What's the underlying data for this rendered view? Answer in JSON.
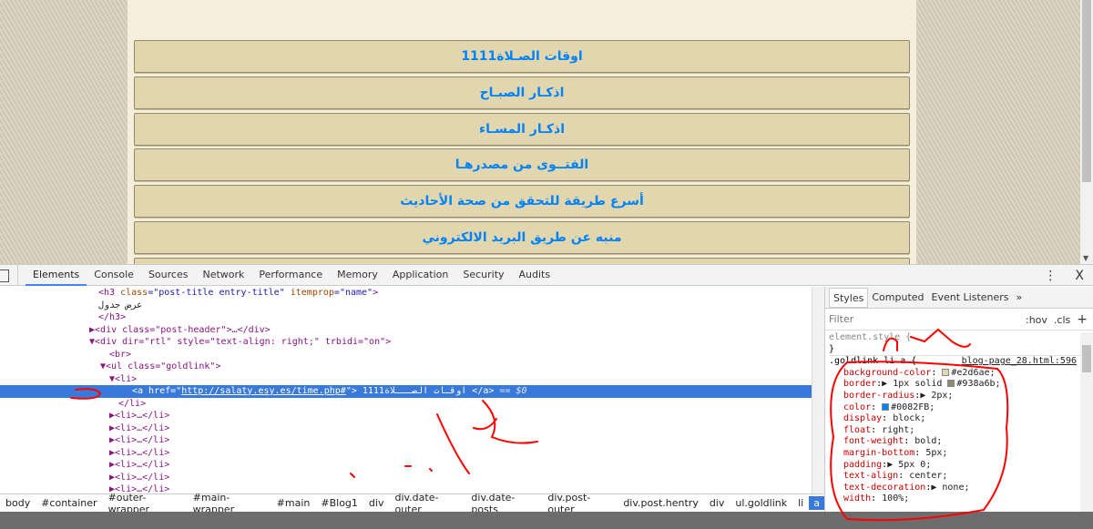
{
  "page": {
    "links": [
      "اوقات الصـلاة1111",
      "اذكـار الصبـاح",
      "اذكـار المسـاء",
      "الفتــوى من مصدرهـا",
      "أسرع طريقة للتحقق من صحة الأحاديث",
      "منبه عن طريق البريد الالكتروني"
    ]
  },
  "devtools": {
    "tabs": [
      "Elements",
      "Console",
      "Sources",
      "Network",
      "Performance",
      "Memory",
      "Application",
      "Security",
      "Audits"
    ],
    "menu_icon": "⋮",
    "close_icon": "X",
    "dom": {
      "l1a": "<h3 ",
      "l1b": "class",
      "l1c": "=\"post-title entry-title\" ",
      "l1d": "itemprop",
      "l1e": "=\"name\"",
      "l1f": ">",
      "l2": "عرض جدول",
      "l3": "</h3>",
      "l4": "<div class=\"post-header\">…</div>",
      "l5": "<div dir=\"rtl\" style=\"text-align: right;\" trbidi=\"on\">",
      "l6": "<br>",
      "l7": "<ul class=\"goldlink\">",
      "l8": "<li>",
      "sel_open": "<a href=\"",
      "sel_href": "http://salaty.esy.es/time.php#",
      "sel_mid": "\"> 1111اوقـات الصـــلاة </a>",
      "sel_eq": " == $0",
      "l10": "</li>",
      "collapsed": "<li>…</li>"
    },
    "breadcrumbs": [
      "body",
      "#container",
      "#outer-wrapper",
      "#main-wrapper",
      "#main",
      "#Blog1",
      "div",
      "div.date-outer",
      "div.date-posts",
      "div.post-outer",
      "div.post.hentry",
      "div",
      "ul.goldlink",
      "li",
      "a"
    ],
    "styles": {
      "tabs": [
        "Styles",
        "Computed",
        "Event Listeners",
        "»"
      ],
      "filter_placeholder": "Filter",
      "hov": ":hov",
      "cls": ".cls",
      "plus": "+",
      "element_style": "element.style {",
      "close_brace": "}",
      "selector": ".goldlink li a {",
      "source": "blog-page_28.html:596",
      "props": [
        {
          "name": "background-color",
          "value": "#e2d6ae;",
          "swatch": "#e2d6ae"
        },
        {
          "name": "border",
          "value": "▶ 1px solid ",
          "value2": "#938a6b;",
          "swatch": "#938a6b"
        },
        {
          "name": "border-radius",
          "value": "▶ 2px;"
        },
        {
          "name": "color",
          "value": "#0082FB;",
          "swatch": "#0082FB"
        },
        {
          "name": "display",
          "value": "block;"
        },
        {
          "name": "float",
          "value": "right;"
        },
        {
          "name": "font-weight",
          "value": "bold;"
        },
        {
          "name": "margin-bottom",
          "value": "5px;"
        },
        {
          "name": "padding",
          "value": "▶ 5px 0;"
        },
        {
          "name": "text-align",
          "value": "center;"
        },
        {
          "name": "text-decoration",
          "value": "▶ none;"
        },
        {
          "name": "width",
          "value": "100%;"
        }
      ]
    }
  }
}
